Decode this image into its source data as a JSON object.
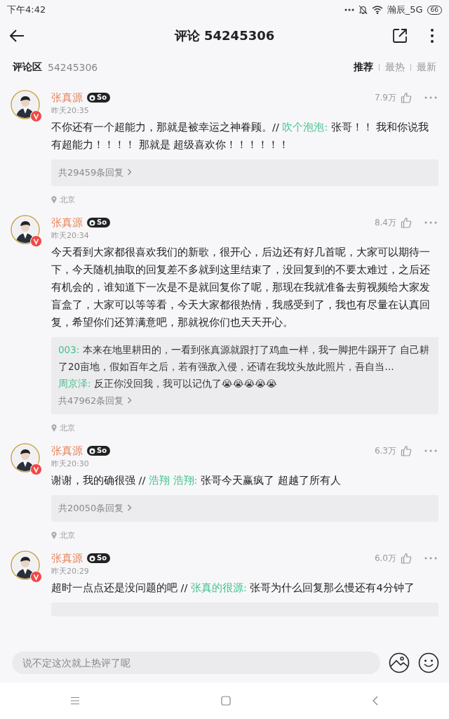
{
  "status_bar": {
    "time": "下午4:42",
    "carrier": "瀚辰_5G",
    "battery": "66"
  },
  "header": {
    "title": "评论 54245306"
  },
  "section": {
    "label": "评论区",
    "count": "54245306",
    "sorts": [
      {
        "label": "推荐",
        "selected": true
      },
      {
        "label": "最热",
        "selected": false
      },
      {
        "label": "最新",
        "selected": false
      }
    ]
  },
  "comments": [
    {
      "user": "张真源",
      "badge": "So",
      "verified": true,
      "time": "昨天20:35",
      "likes": "7.9万",
      "text": "不你还有一个超能力，那就是被幸运之神眷顾。// ",
      "quote_user": "吹个泡泡:",
      "quote_text": " 张哥！！ 我和你说我有超能力！！！！ 那就是 超级喜欢你！！！！！！",
      "reply_count": "共29459条回复",
      "location": "北京"
    },
    {
      "user": "张真源",
      "badge": "So",
      "verified": true,
      "time": "昨天20:34",
      "likes": "8.4万",
      "text": "今天看到大家都很喜欢我们的新歌，很开心，后边还有好几首呢，大家可以期待一下，今天随机抽取的回复差不多就到这里结束了，没回复到的不要太难过，之后还有机会的，谁知道下一次是不是就回复你了呢，那现在我就准备去剪视频给大家发盲盒了，大家可以等等看，今天大家都很热情，我感受到了，我也有尽量在认真回复，希望你们还算满意吧，那就祝你们也天天开心。",
      "replies": [
        {
          "user": "003:",
          "text": " 本来在地里耕田的，一看到张真源就跟打了鸡血一样，我一脚把牛踢开了 自己耕了20亩地，假如百年之后，若有强敌入侵，还请在我坟头放此照片，吾自当…"
        },
        {
          "user": "周京泽:",
          "text": " 反正你没回我，我可以记仇了😭😭😭😭😭"
        }
      ],
      "reply_count": "共47962条回复",
      "location": "北京"
    },
    {
      "user": "张真源",
      "badge": "So",
      "verified": true,
      "time": "昨天20:30",
      "likes": "6.3万",
      "text": "谢谢，我的确很强 // ",
      "quote_user": "浩翔 浩翔:",
      "quote_text": " 张哥今天赢疯了 超越了所有人",
      "reply_count": "共20050条回复",
      "location": "北京"
    },
    {
      "user": "张真源",
      "badge": "So",
      "verified": true,
      "time": "昨天20:29",
      "likes": "6.0万",
      "text": "超时一点点还是没问题的吧 // ",
      "quote_user": "张真的很源:",
      "quote_text": " 张哥为什么回复那么慢还有4分钟了",
      "reply_box_cut": true
    }
  ],
  "composer": {
    "placeholder": "说不定这次就上热评了呢"
  }
}
